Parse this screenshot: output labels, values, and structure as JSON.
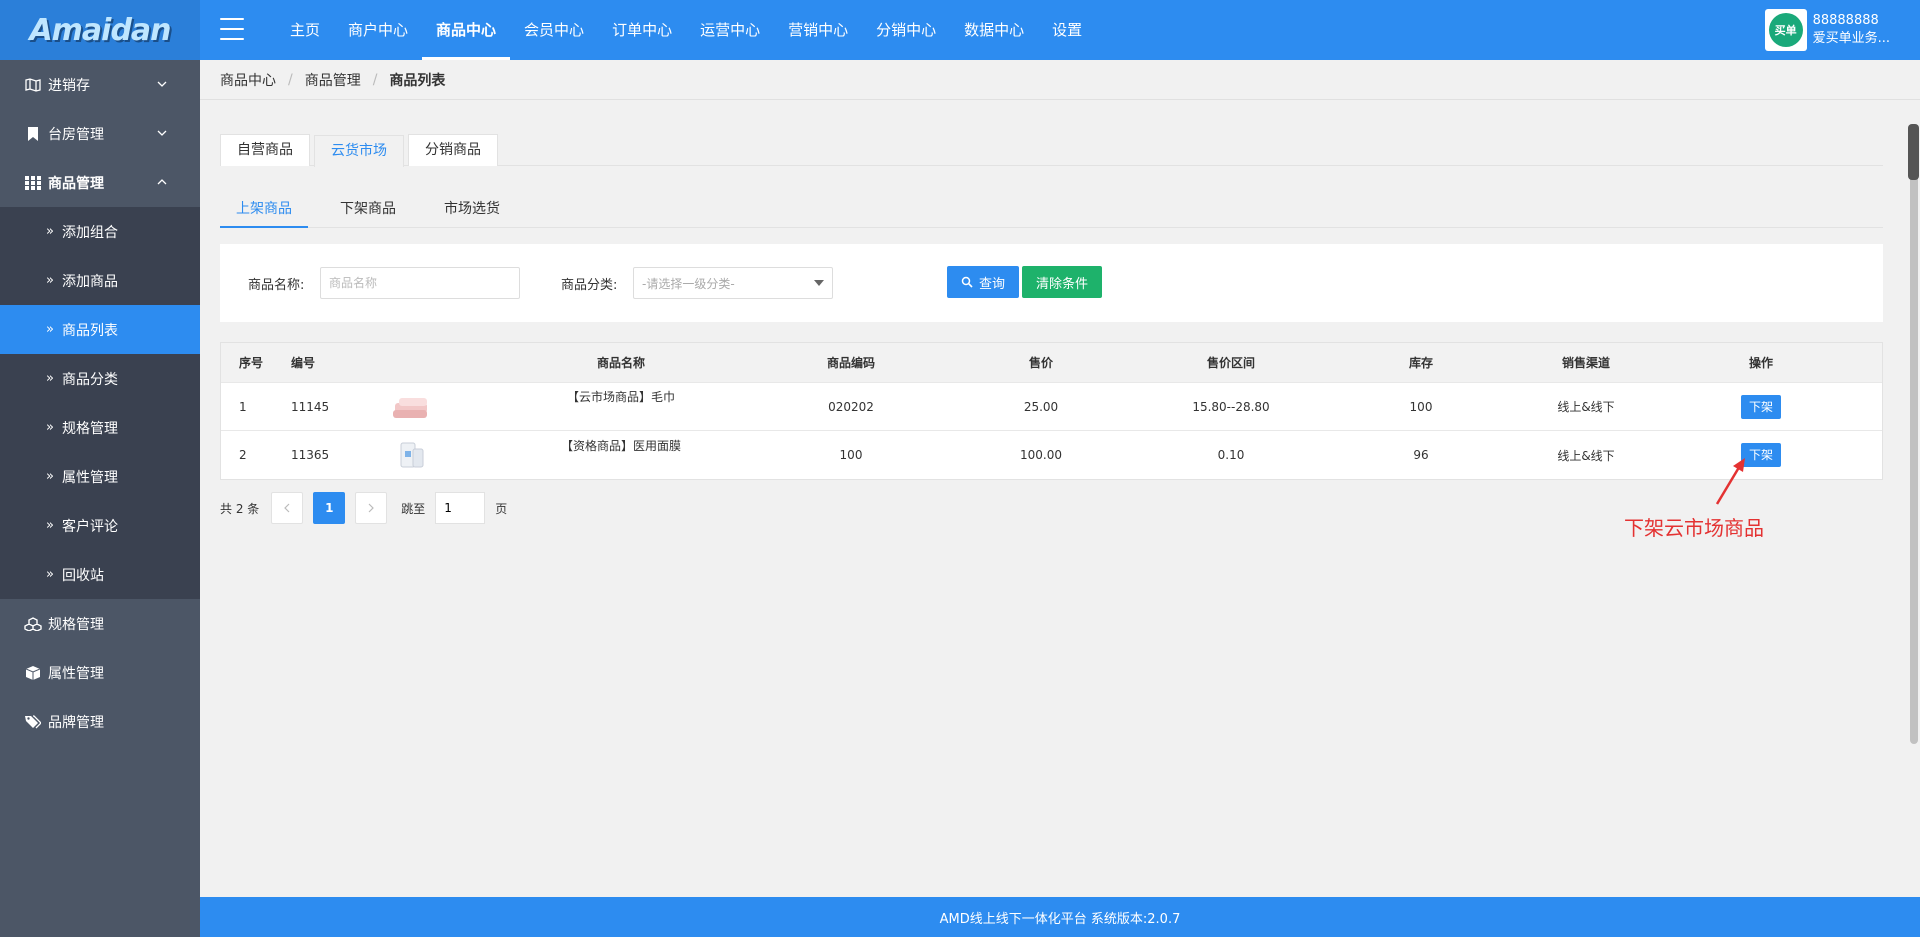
{
  "app": {
    "logo_text": "Amaidan"
  },
  "topnav": {
    "items": [
      {
        "label": "主页"
      },
      {
        "label": "商户中心"
      },
      {
        "label": "商品中心"
      },
      {
        "label": "会员中心"
      },
      {
        "label": "订单中心"
      },
      {
        "label": "运营中心"
      },
      {
        "label": "营销中心"
      },
      {
        "label": "分销中心"
      },
      {
        "label": "数据中心"
      },
      {
        "label": "设置"
      }
    ],
    "active_index": 2
  },
  "user": {
    "avatar_text": "买单",
    "account": "88888888",
    "name": "爱买单业务..."
  },
  "sidebar": {
    "items": [
      {
        "label": "进销存",
        "icon": "map-icon"
      },
      {
        "label": "台房管理",
        "icon": "bookmark-icon"
      },
      {
        "label": "商品管理",
        "icon": "grid-icon"
      }
    ],
    "sub_items": [
      {
        "label": "添加组合"
      },
      {
        "label": "添加商品"
      },
      {
        "label": "商品列表"
      },
      {
        "label": "商品分类"
      },
      {
        "label": "规格管理"
      },
      {
        "label": "属性管理"
      },
      {
        "label": "客户评论"
      },
      {
        "label": "回收站"
      }
    ],
    "bottom_items": [
      {
        "label": "规格管理",
        "icon": "cubes-icon"
      },
      {
        "label": "属性管理",
        "icon": "cube-icon"
      },
      {
        "label": "品牌管理",
        "icon": "tags-icon"
      }
    ]
  },
  "breadcrumb": {
    "level1": "商品中心",
    "level2": "商品管理",
    "level3": "商品列表"
  },
  "tabs_primary": [
    {
      "label": "自营商品"
    },
    {
      "label": "云货市场"
    },
    {
      "label": "分销商品"
    }
  ],
  "tabs_secondary": [
    {
      "label": "上架商品"
    },
    {
      "label": "下架商品"
    },
    {
      "label": "市场选货"
    }
  ],
  "filter": {
    "name_label": "商品名称:",
    "name_placeholder": "商品名称",
    "category_label": "商品分类:",
    "category_placeholder": "-请选择一级分类-",
    "search_label": "查询",
    "clear_label": "清除条件"
  },
  "table": {
    "headers": {
      "seq": "序号",
      "id": "编号",
      "name": "商品名称",
      "code": "商品编码",
      "price": "售价",
      "range": "售价区间",
      "stock": "库存",
      "channel": "销售渠道",
      "op": "操作"
    },
    "rows": [
      {
        "seq": "1",
        "id": "11145",
        "name": "【云市场商品】毛巾",
        "code": "020202",
        "price": "25.00",
        "range": "15.80--28.80",
        "stock": "100",
        "channel": "线上&线下",
        "op": "下架"
      },
      {
        "seq": "2",
        "id": "11365",
        "name": "【资格商品】医用面膜",
        "code": "100",
        "price": "100.00",
        "range": "0.10",
        "stock": "96",
        "channel": "线上&线下",
        "op": "下架"
      }
    ]
  },
  "pager": {
    "total": "共 2 条",
    "current": "1",
    "jump_label": "跳至",
    "jump_value": "1",
    "page_suffix": "页"
  },
  "annotation": {
    "text": "下架云市场商品"
  },
  "footer": {
    "text": "AMD线上线下一体化平台 系统版本:2.0.7"
  }
}
